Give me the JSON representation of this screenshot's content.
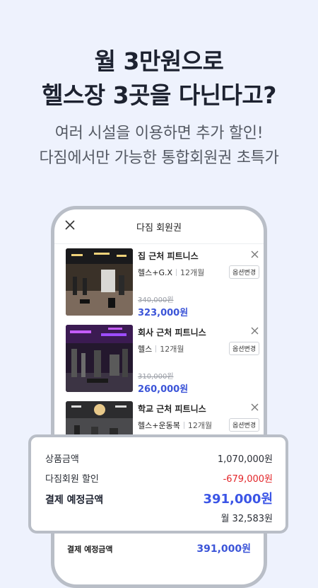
{
  "hero": {
    "line1": "월 3만원으로",
    "line2": "헬스장 3곳을 다닌다고?",
    "sub1": "여러 시설을 이용하면 추가 할인!",
    "sub2": "다짐에서만 가능한 통합회원권 초특가"
  },
  "phone": {
    "title": "다짐 회원권",
    "items": [
      {
        "name": "집 근처 피트니스",
        "product": "헬스+G.X",
        "months": "12개월",
        "option_button": "옵션변경",
        "old_price": "340,000원",
        "new_price": "323,000원"
      },
      {
        "name": "회사 근처 피트니스",
        "product": "헬스",
        "months": "12개월",
        "option_button": "옵션변경",
        "old_price": "310,000원",
        "new_price": "260,000원"
      },
      {
        "name": "학교 근처 피트니스",
        "product": "헬스+운동복",
        "months": "12개월",
        "option_button": "옵션변경"
      }
    ],
    "bottom_label": "결제 예정금액",
    "bottom_amount": "391,000원"
  },
  "summary": {
    "product_label": "상품금액",
    "product_value": "1,070,000원",
    "discount_label": "다짐회원 할인",
    "discount_value": "-679,000원",
    "pay_label": "결제 예정금액",
    "pay_value": "391,000원",
    "monthly": "월 32,583원"
  },
  "colors": {
    "accent": "#3b55e6",
    "discount": "#e3262a",
    "background": "#eef2fd"
  }
}
